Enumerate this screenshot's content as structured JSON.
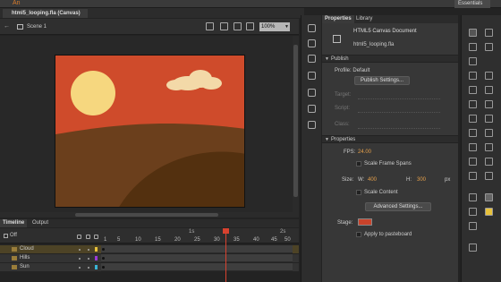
{
  "app": {
    "logo": "An"
  },
  "workspace": {
    "label": "Essentials"
  },
  "document_tab": {
    "title": "html5_looping.fla (Canvas)"
  },
  "scene_bar": {
    "scene_label": "Scene 1",
    "zoom": "100%"
  },
  "timeline": {
    "tabs": [
      "Timeline",
      "Output"
    ],
    "off_label": "Off",
    "second_markers": [
      "1s",
      "2s"
    ],
    "frame_numbers": [
      "1",
      "5",
      "10",
      "15",
      "20",
      "25",
      "30",
      "35",
      "40",
      "45",
      "50"
    ],
    "layers": [
      {
        "name": "Cloud",
        "color": "#e8c23b"
      },
      {
        "name": "Hills",
        "color": "#9b3ad6"
      },
      {
        "name": "Sun",
        "color": "#3ab4d6"
      }
    ]
  },
  "properties": {
    "tabs": [
      "Properties",
      "Library"
    ],
    "doc_type": "HTML5 Canvas Document",
    "doc_name": "html5_looping.fla",
    "publish": {
      "header": "Publish",
      "profile_label": "Profile:",
      "profile_value": "Default",
      "settings_button": "Publish Settings...",
      "target_label": "Target:",
      "script_label": "Script:",
      "class_label": "Class:"
    },
    "props": {
      "header": "Properties",
      "fps_label": "FPS:",
      "fps_value": "24.00",
      "scale_frame_spans": "Scale Frame Spans",
      "size_label": "Size:",
      "w_label": "W:",
      "w_value": "400",
      "h_label": "H:",
      "h_value": "300",
      "unit": "px",
      "scale_content": "Scale Content",
      "advanced_button": "Advanced Settings...",
      "stage_label": "Stage:",
      "stage_color": "#c9432b",
      "apply_pasteboard": "Apply to pasteboard"
    }
  },
  "scene_colors": {
    "sky": "#cf4b2b",
    "sun": "#f6d77f",
    "cloud": "#f3d9a8",
    "hill_back": "#6b3f1c",
    "hill_front": "#53300f"
  }
}
